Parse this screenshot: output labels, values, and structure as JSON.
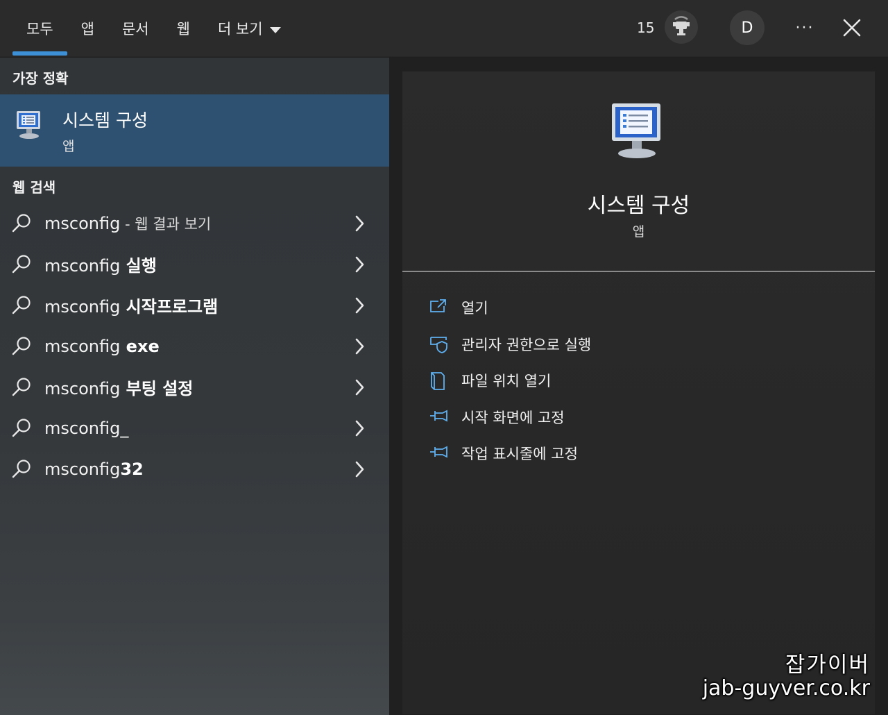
{
  "tabs": [
    {
      "label": "모두",
      "active": true
    },
    {
      "label": "앱"
    },
    {
      "label": "문서"
    },
    {
      "label": "웹"
    },
    {
      "label": "더 보기"
    }
  ],
  "header": {
    "points": "15",
    "avatar_letter": "D",
    "more_label": "···"
  },
  "best_match": {
    "section_label": "가장 정확",
    "name": "시스템 구성",
    "type": "앱"
  },
  "web_search": {
    "section_label": "웹 검색",
    "results": [
      {
        "query": "msconfig",
        "suffix": " - 웹 결과 보기",
        "style": "plain"
      },
      {
        "query": "msconfig",
        "suffix": " 실행",
        "style": "bold"
      },
      {
        "query": "msconfig",
        "suffix": " 시작프로그램",
        "style": "bold"
      },
      {
        "query": "msconfig",
        "suffix": " exe",
        "style": "bold"
      },
      {
        "query": "msconfig",
        "suffix": " 부팅 설정",
        "style": "bold"
      },
      {
        "query": "msconfig",
        "suffix": "_",
        "style": "normal"
      },
      {
        "query": "msconfig",
        "suffix": "32",
        "style": "bold"
      }
    ]
  },
  "preview": {
    "title": "시스템 구성",
    "type": "앱",
    "actions": [
      {
        "label": "열기",
        "icon": "open-icon"
      },
      {
        "label": "관리자 권한으로 실행",
        "icon": "shield-icon"
      },
      {
        "label": "파일 위치 열기",
        "icon": "folder-icon"
      },
      {
        "label": "시작 화면에 고정",
        "icon": "pin-icon"
      },
      {
        "label": "작업 표시줄에 고정",
        "icon": "pin-icon"
      }
    ]
  },
  "watermark": {
    "line1": "잡가이버",
    "line2": "jab-guyver.co.kr"
  },
  "colors": {
    "accent": "#3d8fd6",
    "selected_bg": "#2f5171"
  }
}
